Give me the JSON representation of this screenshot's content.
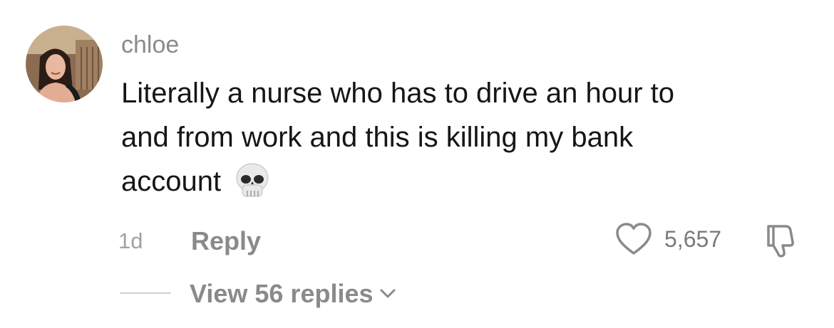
{
  "comment": {
    "author": "chloe",
    "text_lines": [
      "Literally a nurse who has to drive an hour to",
      "and from work and this is killing my bank",
      "account"
    ],
    "emoji_icon": "skull-emoji-icon",
    "avatar_icon": "user-avatar-photo"
  },
  "meta": {
    "timestamp": "1d",
    "reply_label": "Reply",
    "like_count": "5,657",
    "like_icon": "heart-outline-icon",
    "dislike_icon": "thumbs-down-outline-icon"
  },
  "replies": {
    "view_label": "View 56 replies",
    "expand_icon": "chevron-down-icon"
  },
  "colors": {
    "text_primary": "#161616",
    "text_secondary": "#8a8a8a",
    "text_tertiary": "#a1a1a1",
    "background": "#ffffff"
  }
}
